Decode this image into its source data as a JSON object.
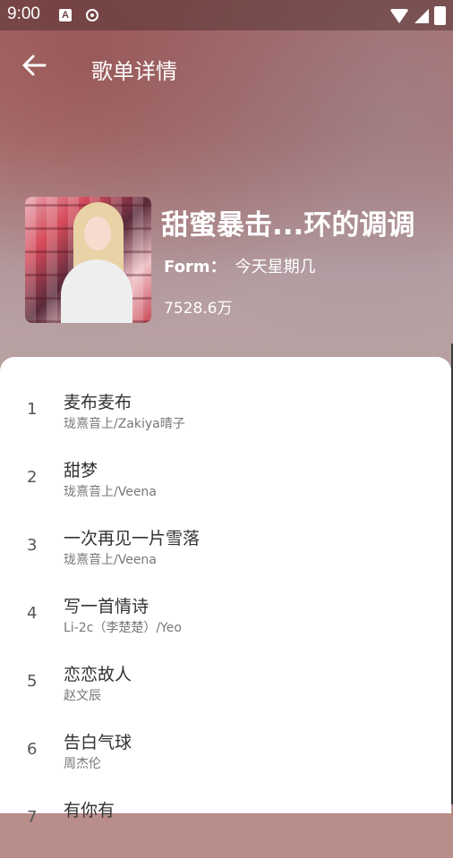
{
  "status_bar": {
    "time": "9:00",
    "notification_letter": "A"
  },
  "header": {
    "title": "歌单详情"
  },
  "playlist": {
    "title": "甜蜜暴击...环的调调",
    "form_label": "Form：",
    "creator": "今天星期几",
    "play_count": "7528.6万"
  },
  "songs": [
    {
      "index": "1",
      "name": "麦布麦布",
      "artist": "珑熹音上/Zakiya晴子"
    },
    {
      "index": "2",
      "name": "甜梦",
      "artist": "珑熹音上/Veena"
    },
    {
      "index": "3",
      "name": "一次再见一片雪落",
      "artist": "珑熹音上/Veena"
    },
    {
      "index": "4",
      "name": "写一首情诗",
      "artist": "Li-2c（李楚楚）/Yeo"
    },
    {
      "index": "5",
      "name": "恋恋故人",
      "artist": "赵文辰"
    },
    {
      "index": "6",
      "name": "告白气球",
      "artist": "周杰伦"
    },
    {
      "index": "7",
      "name": "有你有",
      "artist": ""
    }
  ],
  "icons": {
    "back": "arrow-left-icon",
    "wifi": "wifi-icon",
    "signal": "cell-signal-icon",
    "battery": "battery-icon"
  }
}
